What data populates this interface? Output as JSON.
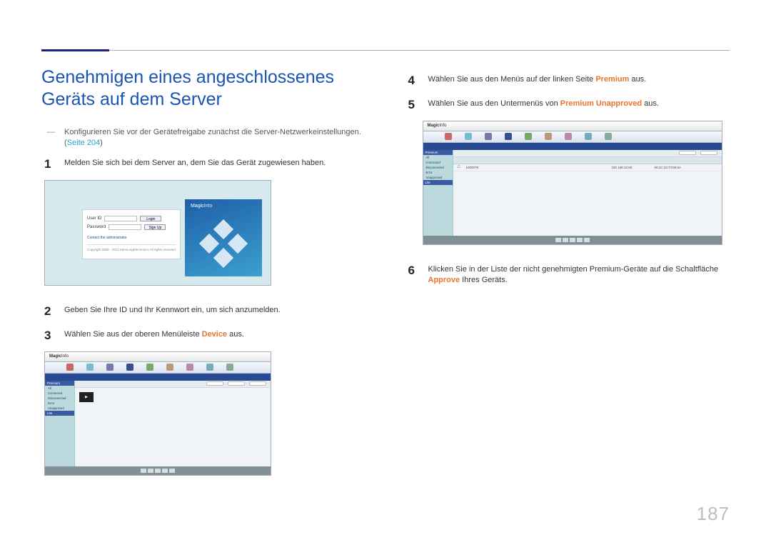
{
  "title": "Genehmigen eines angeschlossenes Geräts auf dem Server",
  "precondition": {
    "text": "Konfigurieren Sie vor der Gerätefreigabe zunächst die Server-Netzwerkeinstellungen. (",
    "link": "Seite 204",
    "tail": ")"
  },
  "steps": {
    "s1": {
      "num": "1",
      "text": "Melden Sie sich bei dem Server an, dem Sie das Gerät zugewiesen haben."
    },
    "s2": {
      "num": "2",
      "text": "Geben Sie Ihre ID und Ihr Kennwort ein, um sich anzumelden."
    },
    "s3": {
      "num": "3",
      "pre": "Wählen Sie aus der oberen Menüleiste ",
      "hl": "Device",
      "post": " aus."
    },
    "s4": {
      "num": "4",
      "pre": "Wählen Sie aus den Menüs auf der linken Seite ",
      "hl": "Premium",
      "post": " aus."
    },
    "s5": {
      "num": "5",
      "pre": "Wählen Sie aus den Untermenüs von ",
      "hl": "Premium Unapproved",
      "post": " aus."
    },
    "s6": {
      "num": "6",
      "pre": "Klicken Sie in der Liste der nicht genehmigten Premium-Geräte auf die Schaltfläche ",
      "hl": "Approve",
      "post": " Ihres Geräts."
    }
  },
  "login": {
    "user_lbl": "User ID",
    "pass_lbl": "Password",
    "login_btn": "Login",
    "signup_btn": "Sign Up",
    "admin_link": "Contact the administrator",
    "copyright": "Copyright 2009 - 2012 SamsungElectronics All rights reserved",
    "logo_a": "Magic",
    "logo_b": "Info"
  },
  "app": {
    "logo_a": "Magic",
    "logo_b": "Info",
    "side_hdr": "Premium",
    "side_items": [
      "All",
      "Connected",
      "Disconnected",
      "Error",
      "Unapproved"
    ],
    "side_hdr2": "Lite"
  },
  "app2": {
    "row": {
      "name": "1000079",
      "ip": "192.168.10.50",
      "mac": "00:1C:23:74:85:6A",
      "model": ""
    }
  },
  "page_number": "187"
}
